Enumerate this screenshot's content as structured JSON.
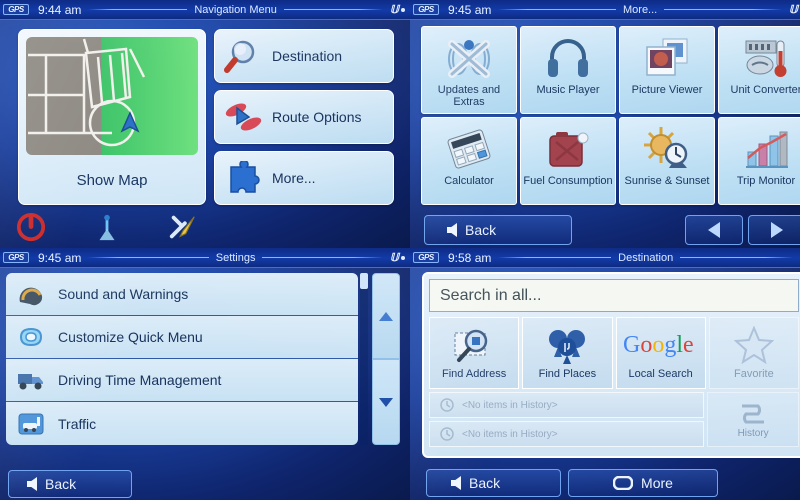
{
  "panels": {
    "nav_menu": {
      "status": {
        "time": "9:44 am",
        "title": "Navigation Menu",
        "logo": "GPS",
        "sat_icon": "satellite-icon"
      },
      "map_button": {
        "label": "Show Map"
      },
      "buttons": [
        {
          "label": "Destination",
          "icon": "magnifier-icon"
        },
        {
          "label": "Route Options",
          "icon": "route-arrow-icon"
        },
        {
          "label": "More...",
          "icon": "puzzle-piece-icon"
        }
      ],
      "tray": [
        {
          "icon": "power-icon",
          "color": "#cc2b2b"
        },
        {
          "icon": "gps-antenna-icon",
          "color": "#4da9f0"
        },
        {
          "icon": "tools-icon",
          "color": "#3f6fb5"
        }
      ]
    },
    "more": {
      "status": {
        "time": "9:45 am",
        "title": "More...",
        "logo": "GPS",
        "sat_icon": "satellite-icon"
      },
      "tiles": [
        {
          "label": "Updates and Extras",
          "icon": "updates-extras-icon"
        },
        {
          "label": "Music Player",
          "icon": "headphones-icon"
        },
        {
          "label": "Picture Viewer",
          "icon": "photos-icon"
        },
        {
          "label": "Unit Converter",
          "icon": "thermometer-icon"
        },
        {
          "label": "Calculator",
          "icon": "calculator-icon"
        },
        {
          "label": "Fuel Consumption",
          "icon": "jerrycan-icon"
        },
        {
          "label": "Sunrise & Sunset",
          "icon": "sun-clock-icon"
        },
        {
          "label": "Trip Monitor",
          "icon": "bar-chart-icon"
        }
      ],
      "back_label": "Back",
      "prev_icon": "chevron-left-icon",
      "next_icon": "chevron-right-icon"
    },
    "settings": {
      "status": {
        "time": "9:45 am",
        "title": "Settings",
        "logo": "GPS",
        "sat_icon": "satellite-icon"
      },
      "rows": [
        {
          "label": "Sound and Warnings",
          "icon": "headset-icon"
        },
        {
          "label": "Customize Quick Menu",
          "icon": "quickmenu-icon"
        },
        {
          "label": "Driving Time Management",
          "icon": "truck-icon"
        },
        {
          "label": "Traffic",
          "icon": "traffic-icon"
        }
      ],
      "scroll_up_icon": "triangle-up-icon",
      "scroll_down_icon": "triangle-down-icon",
      "back_label": "Back"
    },
    "destination": {
      "status": {
        "time": "9:58 am",
        "title": "Destination",
        "logo": "GPS",
        "sat_icon": "satellite-icon"
      },
      "search": {
        "value": "Search in all...",
        "placeholder": "Search in all..."
      },
      "tiles": [
        {
          "label": "Find Address",
          "icon": "address-magnifier-icon"
        },
        {
          "label": "Find Places",
          "icon": "places-pins-icon"
        },
        {
          "label": "Local Search",
          "icon": "google-logo"
        },
        {
          "label": "Favorite",
          "icon": "star-icon"
        }
      ],
      "history_rows": [
        {
          "label": "<No items in History>",
          "icon": "history-item-icon"
        },
        {
          "label": "<No items in History>",
          "icon": "history-item-icon"
        }
      ],
      "side_tile": {
        "label": "History",
        "icon": "history-stack-icon"
      },
      "back_label": "Back",
      "more_label": "More",
      "more_icon": "rounded-square-icon"
    }
  },
  "colors": {
    "screen_blue": "#1a3f9e",
    "tile_light": "#cfe6f6",
    "accent": "#8ab6ff",
    "power_red": "#cc2b2b",
    "map_green": "#3fc46a"
  }
}
